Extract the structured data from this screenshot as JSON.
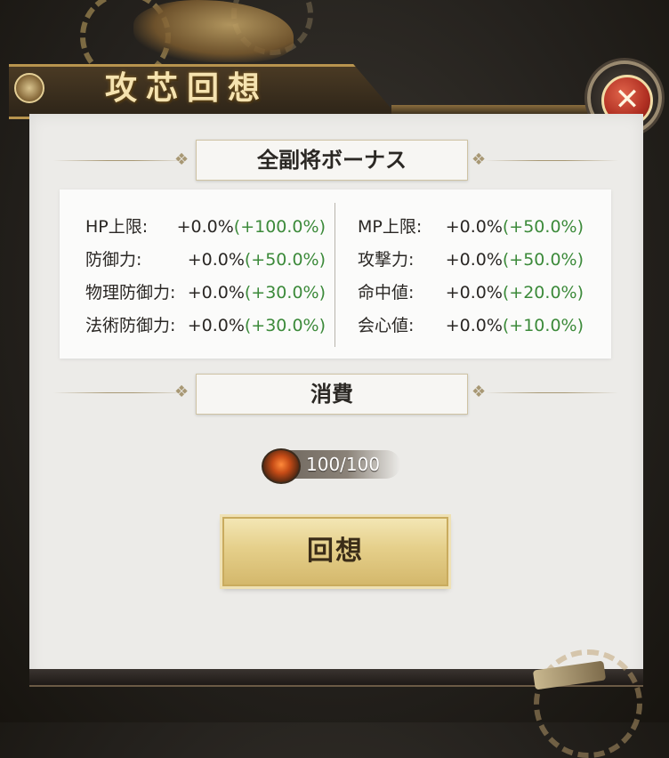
{
  "header": {
    "title": "攻芯回想"
  },
  "close": {
    "icon": "✕"
  },
  "bonus_section": {
    "title": "全副将ボーナス"
  },
  "stats": {
    "left": [
      {
        "label": "HP上限:",
        "current": "+0.0%",
        "bonus": "(+100.0%)"
      },
      {
        "label": "防御力:",
        "current": "+0.0%",
        "bonus": "(+50.0%)"
      },
      {
        "label": "物理防御力:",
        "current": "+0.0%",
        "bonus": "(+30.0%)"
      },
      {
        "label": "法術防御力:",
        "current": "+0.0%",
        "bonus": "(+30.0%)"
      }
    ],
    "right": [
      {
        "label": "MP上限:",
        "current": "+0.0%",
        "bonus": "(+50.0%)"
      },
      {
        "label": "攻撃力:",
        "current": "+0.0%",
        "bonus": "(+50.0%)"
      },
      {
        "label": "命中値:",
        "current": "+0.0%",
        "bonus": "(+20.0%)"
      },
      {
        "label": "会心値:",
        "current": "+0.0%",
        "bonus": "(+10.0%)"
      }
    ]
  },
  "cost_section": {
    "title": "消費",
    "amount": "100/100",
    "item_icon": "lantern-icon"
  },
  "action": {
    "label": "回想"
  },
  "colors": {
    "bonus_green": "#3c8a3a",
    "gold": "#b8944e",
    "close_red": "#b02f22"
  }
}
